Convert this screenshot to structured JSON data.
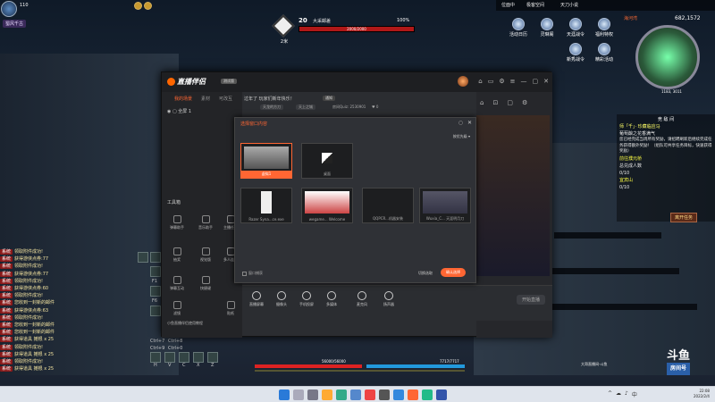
{
  "game": {
    "player_level": "110",
    "player_name": "蜀风千古",
    "boss": {
      "level": "20",
      "name": "大采邮差",
      "hp_text": "2000/2000",
      "percent": "100%",
      "percent_value": 100,
      "distance": "2米"
    },
    "topbar": {
      "tabs": [
        "位面中",
        "极客空间",
        "天刀小说"
      ],
      "map_name": "海河湾",
      "map_sub": "海河湾",
      "money": "682,1572"
    },
    "shortcuts": [
      "活动日历",
      "灵琳阁",
      "天涯战令",
      "福利特权",
      "新秀战令",
      "精彩活动"
    ],
    "coords": "1183, 3011",
    "quest": {
      "title": "竞 敌 间",
      "heading": "师「千」· 珍藏临应马",
      "line1": "葡萄酿之花香满气",
      "body": "您已经完成当周所有奖励，请招聘刷新后继续完成任务获得额外奖励！（组队可共享任务目标，快速获得奖励）",
      "sub1": "前往濮元桥",
      "sub2": "总兑成人数",
      "sub3": "0/10",
      "sub4": "宜宾山",
      "sub5": "0/10",
      "button": "离开任务"
    },
    "chat": [
      {
        "tag": "系统",
        "text": "领取附件成功!"
      },
      {
        "tag": "系统",
        "text": "获得游侠点券:77"
      },
      {
        "tag": "系统",
        "text": "领取附件成功!"
      },
      {
        "tag": "系统",
        "text": "获得游侠点券:77"
      },
      {
        "tag": "系统",
        "text": "领取附件成功!"
      },
      {
        "tag": "系统",
        "text": "获得游侠点券:60"
      },
      {
        "tag": "系统",
        "text": "领取附件成功!"
      },
      {
        "tag": "系统",
        "text": "您收到一封新的邮件"
      },
      {
        "tag": "系统",
        "text": "获得游侠点券:63"
      },
      {
        "tag": "系统",
        "text": "领取附件成功!"
      },
      {
        "tag": "系统",
        "text": "您收到一封新的邮件"
      },
      {
        "tag": "系统",
        "text": "您收到一封新的邮件"
      },
      {
        "tag": "系统",
        "text": "获得道具 摊根 x 25"
      },
      {
        "tag": "系统",
        "text": "领取附件成功!"
      },
      {
        "tag": "系统",
        "text": "获得道具 摊根 x 25"
      },
      {
        "tag": "系统",
        "text": "领取附件成功!"
      },
      {
        "tag": "系统",
        "text": "获得道具 摊根 x 25"
      }
    ],
    "skill_keys": [
      "F1",
      "F6",
      "Ctrl+7",
      "Ctrl+8",
      "Ctrl+9",
      "Ctrl+0",
      "H",
      "V",
      "C",
      "X",
      "Z"
    ],
    "hp_text": "56000/56000",
    "mp_text": "7717/7717",
    "live_text": "大哥直播间-斗鱼",
    "douyu": {
      "logo": "斗鱼",
      "sub": "房间号"
    }
  },
  "app": {
    "title": "直播伴侣",
    "version": "测试版",
    "tabs": [
      "我的场景",
      "素材",
      "可改互"
    ],
    "scene_item": "全屏 1",
    "notice": "过年了 玩家们新年快乐！",
    "notice_btn": "通知",
    "notice2_pills": [
      "天龙的方刀",
      "天上之城"
    ],
    "room": "房间Quiz: 2530901",
    "likes": "0",
    "tools_title": "工具箱",
    "tools": [
      "弹幕助手",
      "音乐助手",
      "主播任务",
      "抽奖",
      "视觉版",
      "多人连麦",
      "弹幕互动",
      "快捷键",
      "滤镜",
      "贴纸"
    ],
    "bottom_actions": [
      "直播屏幕",
      "摄像头",
      "手机投屏",
      "多媒体",
      "麦克风",
      "扬声器"
    ],
    "start_btn": "开始直播",
    "notice3": "小鱼直播伴侣使用教程",
    "header_icons": [
      "⌂",
      "▭",
      "⚙",
      "≡",
      "—",
      "▢",
      "✕"
    ],
    "right_icons": [
      "⌂",
      "⊡",
      "▢",
      "⚙"
    ]
  },
  "dialog": {
    "title": "选择窗口内容",
    "sort": "按优先级",
    "windows": [
      {
        "label": "虚拟1",
        "selected": true
      },
      {
        "label": "桌面",
        "selected": false
      },
      {
        "label": "Razer Syna...ce.exe",
        "selected": false
      },
      {
        "label": "wegame... Welcome",
        "selected": false
      },
      {
        "label": "QQPCR...机器安装",
        "selected": false
      },
      {
        "label": "Wuxia_C... 天涯明月刀",
        "selected": false
      }
    ],
    "checkbox_label": "窗口捕获",
    "cancel": "切换选取",
    "confirm": "确认选择"
  },
  "taskbar": {
    "time": "22:08",
    "date": "2022/2/4",
    "tray": [
      "^",
      "☁",
      "♪",
      "中"
    ]
  },
  "colors": {
    "accent": "#ff6633",
    "boss_hp": "#b01818",
    "hp": "#dd2222",
    "mp": "#2299dd"
  }
}
